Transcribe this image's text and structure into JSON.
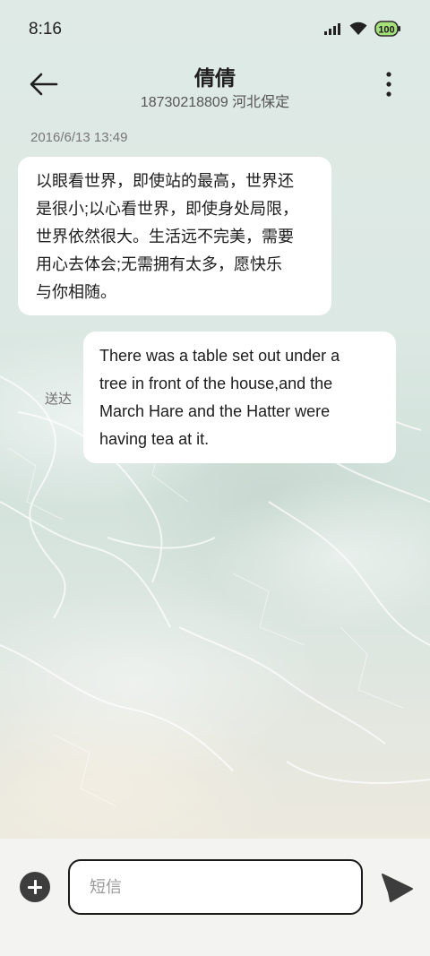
{
  "status_bar": {
    "time": "8:16",
    "battery": "100",
    "icons": [
      "signal-icon",
      "wifi-icon",
      "battery-icon"
    ]
  },
  "header": {
    "title": "倩倩",
    "subtitle": "18730218809 河北保定",
    "back_icon": "arrow-left-icon",
    "more_icon": "more-vertical-icon"
  },
  "conversation": {
    "timestamp": "2016/6/13 13:49",
    "messages": [
      {
        "direction": "incoming",
        "lines": [
          "以眼看世界，即使站的最高，世界还",
          "是很小;以心看世界，即使身处局限，",
          "世界依然很大。生活远不完美，需要",
          "用心去体会;无需拥有太多，愿快乐",
          "与你相随。"
        ]
      },
      {
        "direction": "outgoing",
        "status": "送达",
        "lines": [
          "There was a table set out under a",
          "tree in front of the house,and the",
          "March Hare and the Hatter were",
          "having tea at it."
        ]
      }
    ]
  },
  "composer": {
    "placeholder": "短信",
    "value": "",
    "add_icon": "plus-circle-icon",
    "send_icon": "send-icon"
  },
  "colors": {
    "bubble": "#ffffff",
    "background_top": "#dfeae6",
    "bottom_bar": "#f3f3f2",
    "battery_fill": "#a6e07a"
  }
}
